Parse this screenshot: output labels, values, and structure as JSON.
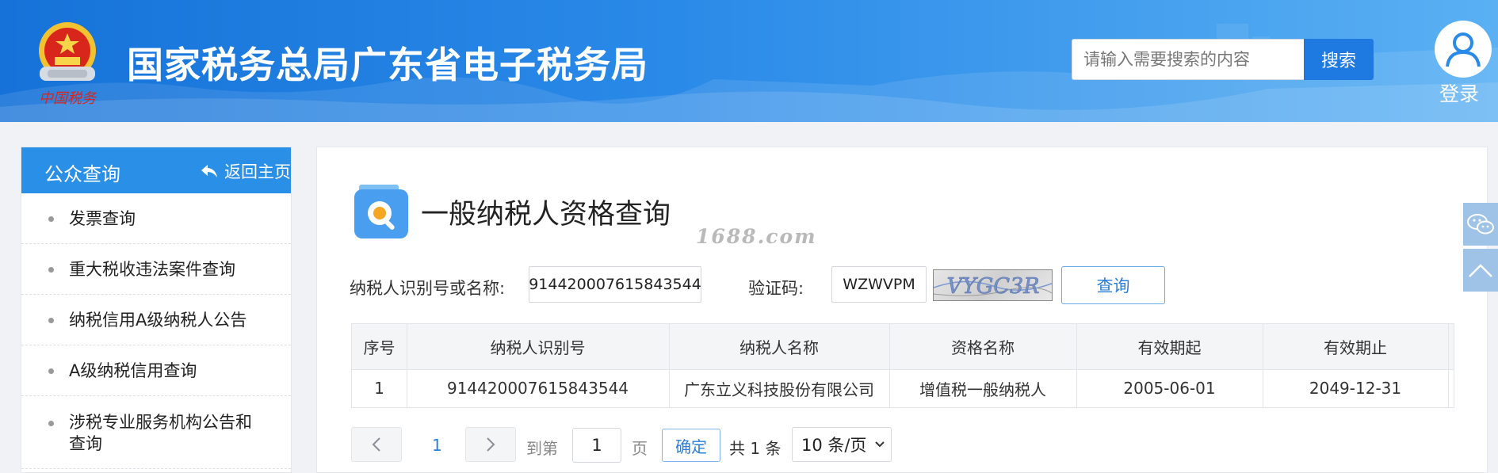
{
  "header": {
    "site_title": "国家税务总局广东省电子税务局",
    "emblem_text": "中国税务",
    "search_placeholder": "请输入需要搜索的内容",
    "search_button": "搜索",
    "login_label": "登录"
  },
  "sidebar": {
    "title": "公众查询",
    "back_label": "返回主页",
    "items": [
      {
        "label": "发票查询"
      },
      {
        "label": "重大税收违法案件查询"
      },
      {
        "label": "纳税信用A级纳税人公告"
      },
      {
        "label": "A级纳税信用查询"
      },
      {
        "label": "涉税专业服务机构公告和查询"
      }
    ]
  },
  "main": {
    "title": "一般纳税人资格查询",
    "watermark": "1688.com",
    "form": {
      "taxpayer_label": "纳税人识别号或名称:",
      "taxpayer_value": "914420007615843544",
      "captcha_label": "验证码:",
      "captcha_value": "WZWVPM",
      "captcha_image_text": "VYGC3R",
      "query_button": "查询"
    },
    "table": {
      "headers": [
        "序号",
        "纳税人识别号",
        "纳税人名称",
        "资格名称",
        "有效期起",
        "有效期止"
      ],
      "rows": [
        [
          "1",
          "914420007615843544",
          "广东立义科技股份有限公司",
          "增值税一般纳税人",
          "2005-06-01",
          "2049-12-31"
        ]
      ]
    },
    "pagination": {
      "current_page": "1",
      "goto_label": "到第",
      "goto_value": "1",
      "page_suffix": "页",
      "confirm_button": "确定",
      "total_text": "共 1 条",
      "page_size": "10 条/页"
    }
  },
  "colors": {
    "header_blue": "#1672d8",
    "sidebar_head": "#2a8fe6",
    "link_blue": "#2a7fdb"
  }
}
